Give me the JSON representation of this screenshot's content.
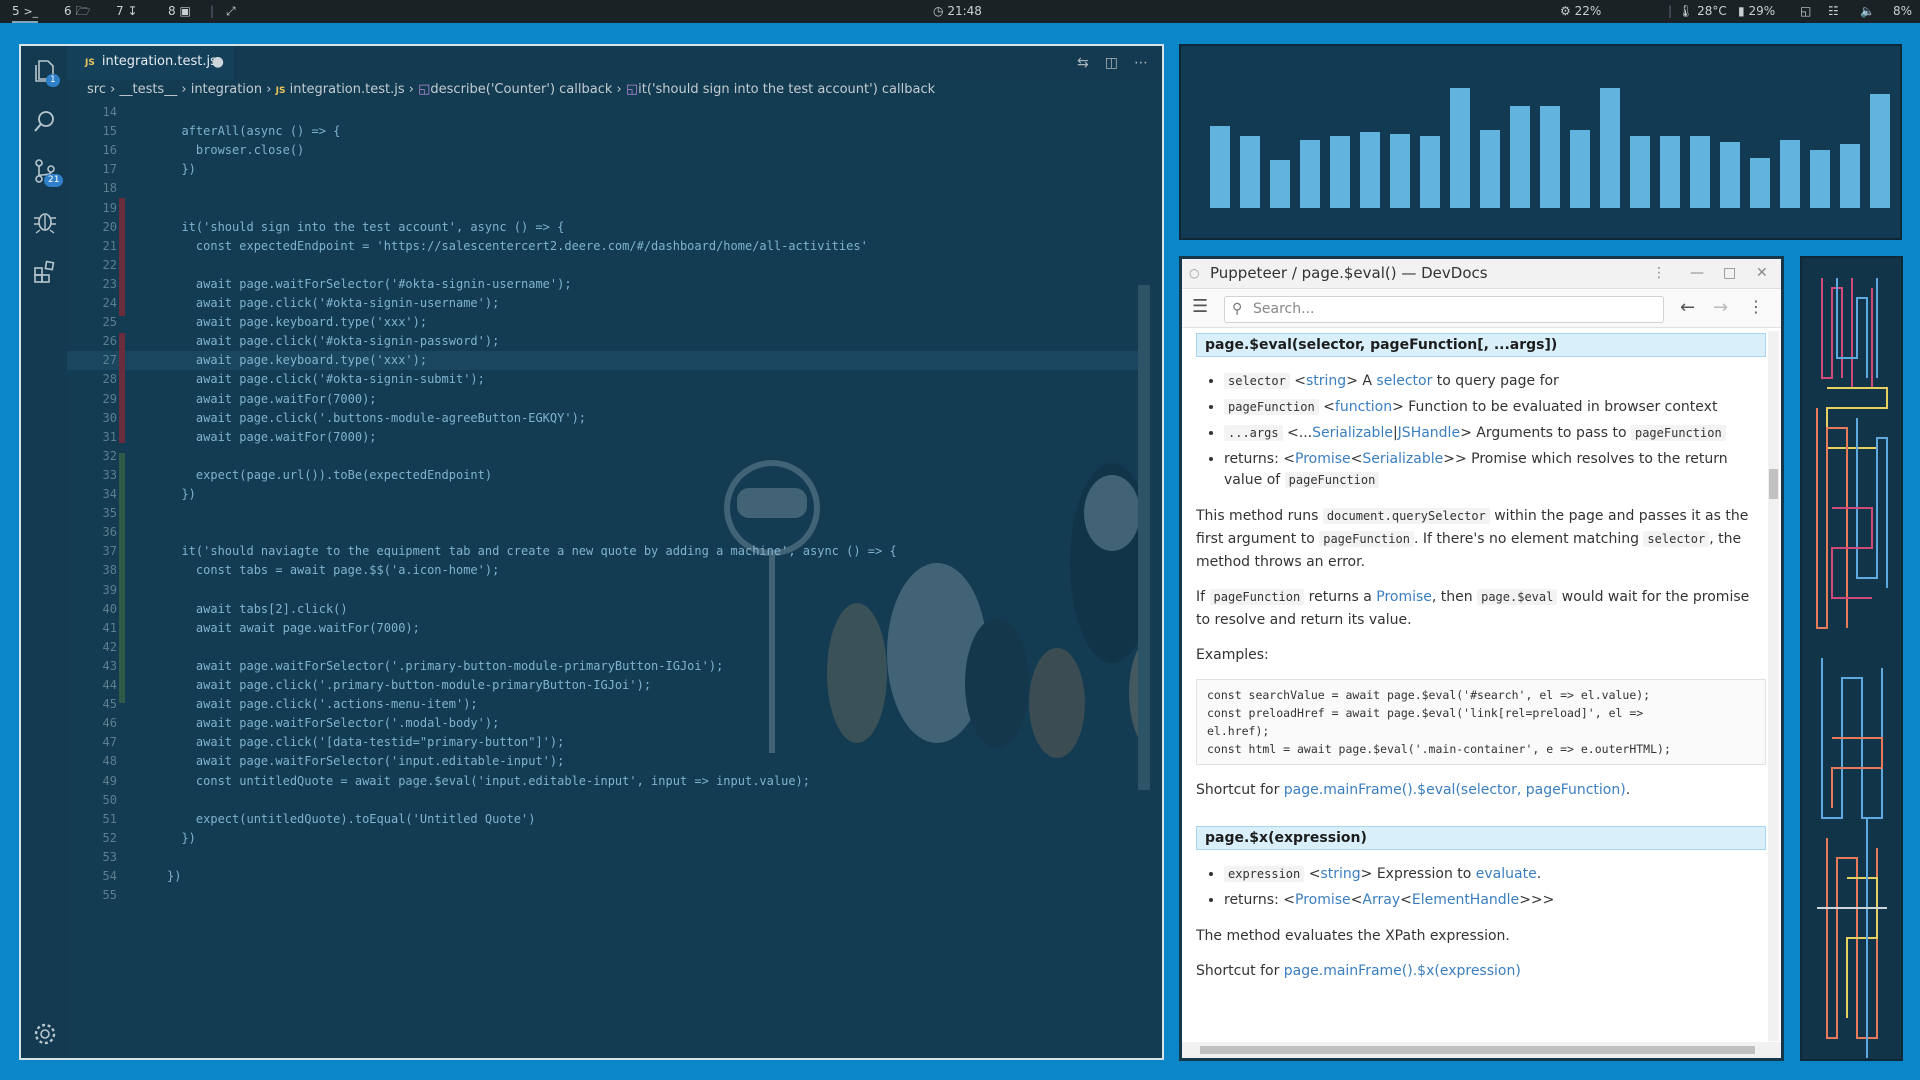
{
  "topbar": {
    "workspaces": [
      {
        "num": "5",
        "icon": ">_",
        "active": true
      },
      {
        "num": "6",
        "icon": "folder"
      },
      {
        "num": "7",
        "icon": "download"
      },
      {
        "num": "8",
        "icon": "window"
      }
    ],
    "clock": "21:48",
    "cpu": "22%",
    "temp": "28°C",
    "memory": "29%",
    "volume": "8%"
  },
  "vscode": {
    "tab_label": "integration.test.js",
    "tab_type": "JS",
    "scm_badge": "21",
    "explorer_badge": "1",
    "breadcrumbs": [
      "src",
      "__tests__",
      "integration",
      "integration.test.js",
      "describe('Counter') callback",
      "it('should sign into the test account') callback"
    ],
    "lines": [
      {
        "n": "14",
        "t": ""
      },
      {
        "n": "15",
        "t": "  afterAll(async () => {"
      },
      {
        "n": "16",
        "t": "    browser.close()"
      },
      {
        "n": "17",
        "t": "  })"
      },
      {
        "n": "18",
        "t": ""
      },
      {
        "n": "19",
        "t": ""
      },
      {
        "n": "20",
        "t": "  it('should sign into the test account', async () => {"
      },
      {
        "n": "21",
        "t": "    const expectedEndpoint = 'https://salescentercert2.deere.com/#/dashboard/home/all-activities'"
      },
      {
        "n": "22",
        "t": ""
      },
      {
        "n": "23",
        "t": "    await page.waitForSelector('#okta-signin-username');"
      },
      {
        "n": "24",
        "t": "    await page.click('#okta-signin-username');"
      },
      {
        "n": "25",
        "t": "    await page.keyboard.type('xxx');"
      },
      {
        "n": "26",
        "t": "    await page.click('#okta-signin-password');"
      },
      {
        "n": "27",
        "t": "    await page.keyboard.type('xxx');"
      },
      {
        "n": "28",
        "t": "    await page.click('#okta-signin-submit');"
      },
      {
        "n": "29",
        "t": "    await page.waitFor(7000);"
      },
      {
        "n": "30",
        "t": "    await page.click('.buttons-module-agreeButton-EGKQY');"
      },
      {
        "n": "31",
        "t": "    await page.waitFor(7000);"
      },
      {
        "n": "32",
        "t": ""
      },
      {
        "n": "33",
        "t": "    expect(page.url()).toBe(expectedEndpoint)"
      },
      {
        "n": "34",
        "t": "  })"
      },
      {
        "n": "35",
        "t": ""
      },
      {
        "n": "36",
        "t": ""
      },
      {
        "n": "37",
        "t": "  it('should naviagte to the equipment tab and create a new quote by adding a machine', async () => {"
      },
      {
        "n": "38",
        "t": "    const tabs = await page.$$('a.icon-home');"
      },
      {
        "n": "39",
        "t": ""
      },
      {
        "n": "40",
        "t": "    await tabs[2].click()"
      },
      {
        "n": "41",
        "t": "    await await page.waitFor(7000);"
      },
      {
        "n": "42",
        "t": ""
      },
      {
        "n": "43",
        "t": "    await page.waitForSelector('.primary-button-module-primaryButton-IGJoi');"
      },
      {
        "n": "44",
        "t": "    await page.click('.primary-button-module-primaryButton-IGJoi');"
      },
      {
        "n": "45",
        "t": "    await page.click('.actions-menu-item');"
      },
      {
        "n": "46",
        "t": "    await page.waitForSelector('.modal-body');"
      },
      {
        "n": "47",
        "t": "    await page.click('[data-testid=\"primary-button\"]');"
      },
      {
        "n": "48",
        "t": "    await page.waitForSelector('input.editable-input');"
      },
      {
        "n": "49",
        "t": "    const untitledQuote = await page.$eval('input.editable-input', input => input.value);"
      },
      {
        "n": "50",
        "t": ""
      },
      {
        "n": "51",
        "t": "    expect(untitledQuote).toEqual('Untitled Quote')"
      },
      {
        "n": "52",
        "t": "  })"
      },
      {
        "n": "53",
        "t": ""
      },
      {
        "n": "54",
        "t": "})"
      },
      {
        "n": "55",
        "t": ""
      }
    ]
  },
  "visualizer": {
    "levels": [
      0.68,
      0.6,
      0.4,
      0.57,
      0.6,
      0.63,
      0.62,
      0.6,
      1.0,
      0.65,
      0.85,
      0.85,
      0.65,
      1.0,
      0.6,
      0.6,
      0.6,
      0.55,
      0.42,
      0.57,
      0.48,
      0.53,
      0.95
    ],
    "color": "#62b3de"
  },
  "devdocs": {
    "window_title": "Puppeteer / page.$eval() — DevDocs",
    "search_placeholder": "Search...",
    "sig1": "page.$eval(selector, pageFunction[, ...args])",
    "p1_li1_code": "selector",
    "p1_li1_lt": "<",
    "p1_li1_type": "string",
    "p1_li1_gt": "> A ",
    "p1_li1_link": "selector",
    "p1_li1_rest": " to query page for",
    "p1_li2_code": "pageFunction",
    "p1_li2_lt": "<",
    "p1_li2_type": "function",
    "p1_li2_gt": "> Function to be evaluated in browser context",
    "p1_li3_code": "...args",
    "p1_li3_lt": "<...",
    "p1_li3_type": "Serializable",
    "p1_li3_sep": "|",
    "p1_li3_type2": "JSHandle",
    "p1_li3_gt": "> Arguments to pass to ",
    "p1_li3_code2": "pageFunction",
    "p1_li4_a": "returns: <",
    "p1_li4_type": "Promise",
    "p1_li4_b": "<",
    "p1_li4_type2": "Serializable",
    "p1_li4_c": ">> Promise which resolves to the return value of ",
    "p1_li4_code": "pageFunction",
    "para1_a": "This method runs ",
    "para1_code1": "document.querySelector",
    "para1_b": " within the page and passes it as the first argument to ",
    "para1_code2": "pageFunction",
    "para1_c": ". If there's no element matching ",
    "para1_code3": "selector",
    "para1_d": ", the method throws an error.",
    "para2_a": "If ",
    "para2_code1": "pageFunction",
    "para2_b": " returns a ",
    "para2_link": "Promise",
    "para2_c": ", then ",
    "para2_code2": "page.$eval",
    "para2_d": " would wait for the promise to resolve and return its value.",
    "examples_label": "Examples:",
    "code_l1": "const searchValue = await page.$eval('#search', el => el.value);",
    "code_l2": "const preloadHref = await page.$eval('link[rel=preload]', el =>",
    "code_l3": "el.href);",
    "code_l4": "const html = await page.$eval('.main-container', e => e.outerHTML);",
    "shortcut1_a": "Shortcut for ",
    "shortcut1_link": "page.mainFrame().$eval(selector, pageFunction)",
    "shortcut1_b": ".",
    "sig2": "page.$x(expression)",
    "p2_li1_code": "expression",
    "p2_li1_lt": "<",
    "p2_li1_type": "string",
    "p2_li1_gt": "> Expression to ",
    "p2_li1_link": "evaluate",
    "p2_li1_end": ".",
    "p2_li2_a": "returns: <",
    "p2_li2_type": "Promise",
    "p2_li2_b": "<",
    "p2_li2_type2": "Array",
    "p2_li2_c": "<",
    "p2_li2_type3": "ElementHandle",
    "p2_li2_d": ">>>",
    "para3": "The method evaluates the XPath expression.",
    "shortcut2_a": "Shortcut for ",
    "shortcut2_link": "page.mainFrame().$x(expression)"
  }
}
